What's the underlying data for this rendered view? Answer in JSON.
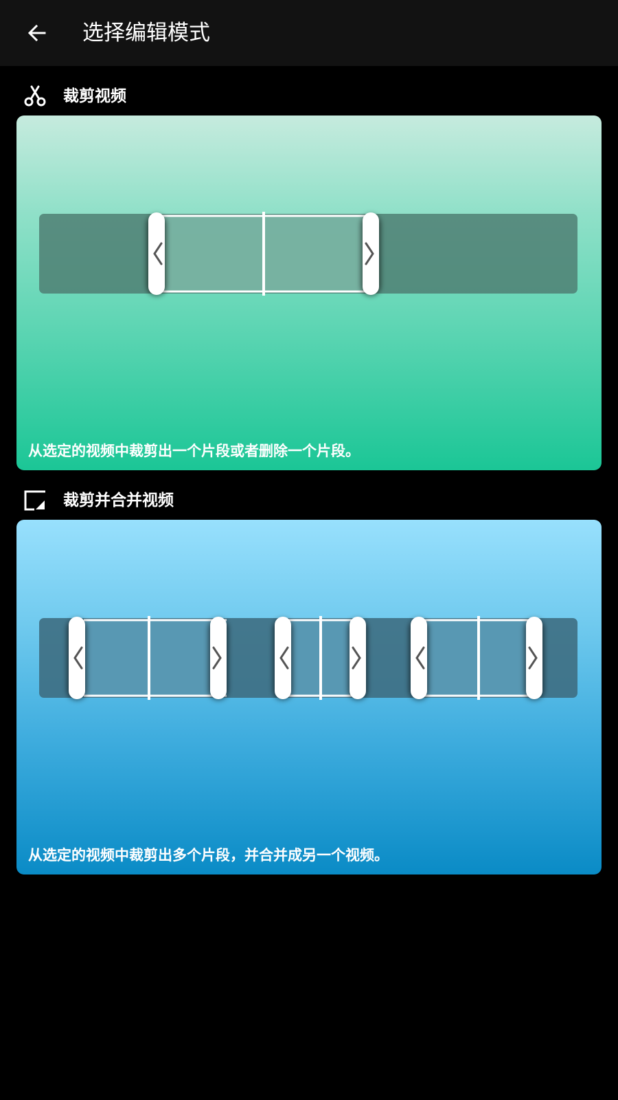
{
  "app_bar": {
    "title": "选择编辑模式",
    "back_icon": "arrow-left-icon"
  },
  "modes": [
    {
      "icon": "scissors-icon",
      "title": "裁剪视频",
      "description": "从选定的视频中裁剪出一个片段或者删除一个片段。",
      "accent_colors": [
        "#c6ebde",
        "#1bc696"
      ]
    },
    {
      "icon": "trim-merge-icon",
      "title": "裁剪并合并视频",
      "description": "从选定的视频中裁剪出多个片段，并合并成另一个视频。",
      "accent_colors": [
        "#98e0fd",
        "#0a8bc6"
      ]
    }
  ]
}
